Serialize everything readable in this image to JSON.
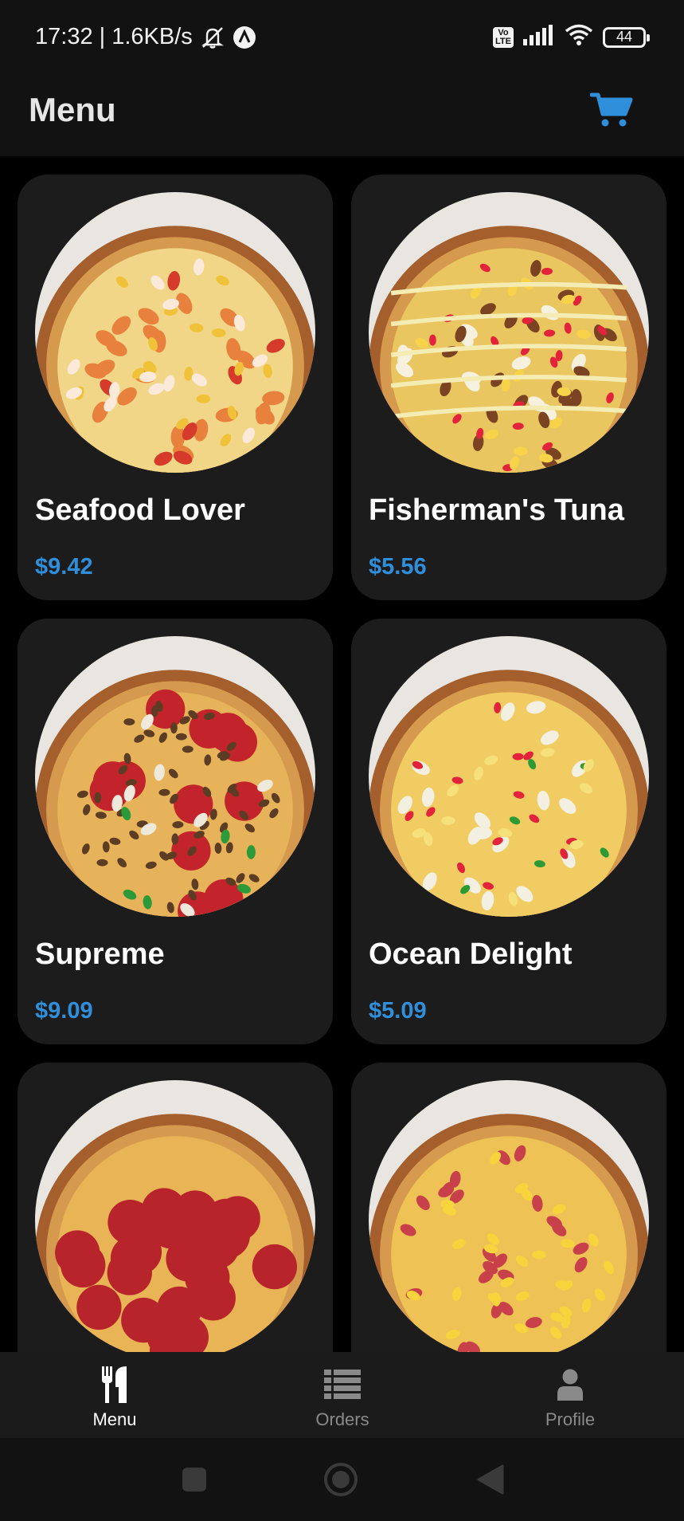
{
  "status_bar": {
    "time_speed": "17:32 | 1.6KB/s",
    "volte_badge": "Vo\nLTE",
    "battery_level": "44",
    "icons": [
      "mute-bell-icon",
      "a-circle-icon",
      "volte-icon",
      "signal-icon",
      "wifi-icon",
      "battery-icon"
    ]
  },
  "app_bar": {
    "title": "Menu",
    "cart_icon": "shopping-cart-icon"
  },
  "colors": {
    "accent": "#2f8fdb",
    "card_bg": "#1c1c1c",
    "nav_inactive": "#8a8a8a"
  },
  "menu": {
    "items": [
      {
        "name": "Seafood Lover",
        "price": "$9.42",
        "style": "seafood"
      },
      {
        "name": "Fisherman's Tuna",
        "price": "$5.56",
        "style": "tuna"
      },
      {
        "name": "Supreme",
        "price": "$9.09",
        "style": "supreme"
      },
      {
        "name": "Ocean Delight",
        "price": "$5.09",
        "style": "ocean"
      },
      {
        "name": "",
        "price": "",
        "style": "pepperoni"
      },
      {
        "name": "",
        "price": "",
        "style": "hawaiian"
      }
    ]
  },
  "bottom_nav": {
    "active": "menu",
    "items": [
      {
        "id": "menu",
        "label": "Menu",
        "icon": "fork-knife-icon"
      },
      {
        "id": "orders",
        "label": "Orders",
        "icon": "list-icon"
      },
      {
        "id": "profile",
        "label": "Profile",
        "icon": "person-icon"
      }
    ]
  },
  "system_nav": {
    "buttons": [
      "recents-square-icon",
      "home-circle-icon",
      "back-triangle-icon"
    ]
  }
}
